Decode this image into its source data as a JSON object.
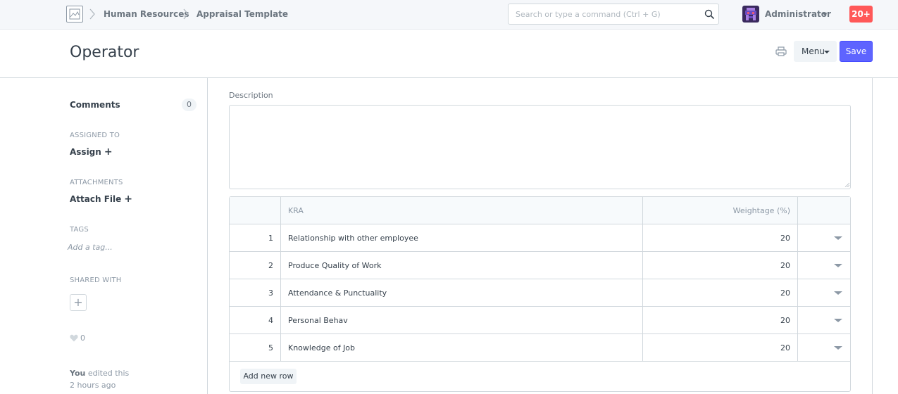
{
  "navbar": {
    "breadcrumbs": [
      "Human Resources",
      "Appraisal Template"
    ],
    "search_placeholder": "Search or type a command (Ctrl + G)",
    "user_name": "Administrator",
    "notification_count": "20+"
  },
  "page": {
    "title": "Operator",
    "menu_label": "Menu",
    "save_label": "Save"
  },
  "sidebar": {
    "comments_label": "Comments",
    "comments_count": "0",
    "assigned_heading": "ASSIGNED TO",
    "assign_label": "Assign",
    "attachments_heading": "ATTACHMENTS",
    "attach_label": "Attach File",
    "tags_heading": "TAGS",
    "tag_placeholder": "Add a tag...",
    "shared_heading": "SHARED WITH",
    "likes_count": "0",
    "activity_user": "You",
    "activity_action": " edited this",
    "activity_time": "2 hours ago"
  },
  "form": {
    "description_label": "Description",
    "description_value": "",
    "grid": {
      "columns": [
        "KRA",
        "Weightage (%)"
      ],
      "rows": [
        {
          "idx": "1",
          "kra": "Relationship with other employee",
          "weightage": "20"
        },
        {
          "idx": "2",
          "kra": "Produce Quality of Work",
          "weightage": "20"
        },
        {
          "idx": "3",
          "kra": "Attendance & Punctuality",
          "weightage": "20"
        },
        {
          "idx": "4",
          "kra": "Personal Behav",
          "weightage": "20"
        },
        {
          "idx": "5",
          "kra": "Knowledge of Job",
          "weightage": "20"
        }
      ],
      "add_row_label": "Add new row"
    }
  },
  "colors": {
    "primary": "#5e64ff",
    "notification": "#ff5858",
    "border": "#d1d8dd",
    "navbar_bg": "#f5f7fa"
  }
}
